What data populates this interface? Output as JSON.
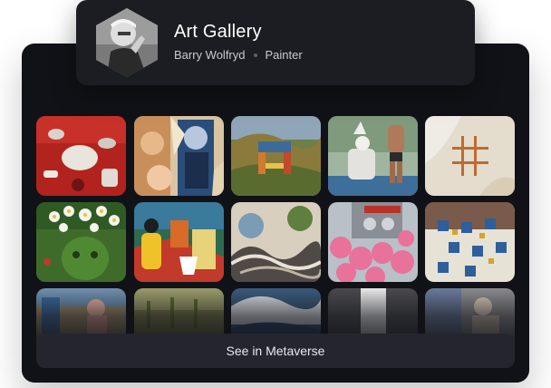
{
  "header": {
    "title": "Art Gallery",
    "artist_name": "Barry Wolfryd",
    "artist_role": "Painter"
  },
  "gallery": {
    "tiles": [
      {
        "name": "artwork-red-figures"
      },
      {
        "name": "artwork-pop-faces"
      },
      {
        "name": "artwork-hills-arch"
      },
      {
        "name": "artwork-figures-landscape"
      },
      {
        "name": "artwork-sticks-sand"
      },
      {
        "name": "artwork-green-head-flowers"
      },
      {
        "name": "artwork-yellow-figures"
      },
      {
        "name": "artwork-wave-circles"
      },
      {
        "name": "artwork-pink-flowers"
      },
      {
        "name": "artwork-patterned-grid"
      },
      {
        "name": "artwork-row3-1"
      },
      {
        "name": "artwork-row3-2"
      },
      {
        "name": "artwork-row3-3"
      },
      {
        "name": "artwork-row3-4"
      },
      {
        "name": "artwork-row3-5"
      }
    ]
  },
  "cta": {
    "label": "See in Metaverse"
  },
  "colors": {
    "panel_bg": "#111217",
    "header_bg": "#1c1d23",
    "button_bg": "#25262d"
  }
}
